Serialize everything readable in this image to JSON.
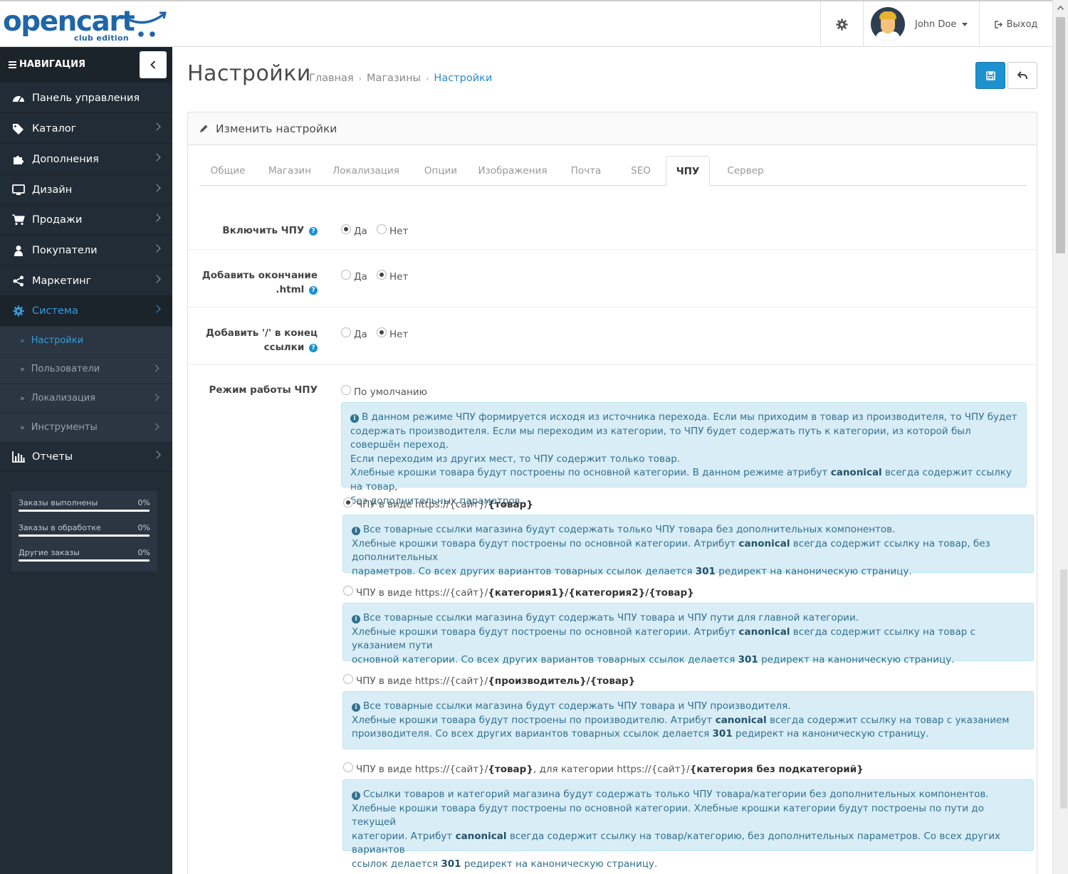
{
  "header": {
    "logo_text": "opencart",
    "logo_sub": "club edition",
    "user_name": "John Doe",
    "logout_label": "Выход"
  },
  "sidebar": {
    "nav_title": "НАВИГАЦИЯ",
    "items": [
      {
        "label": "Панель управления",
        "icon": "dashboard-icon"
      },
      {
        "label": "Каталог",
        "icon": "tags-icon"
      },
      {
        "label": "Дополнения",
        "icon": "puzzle-icon"
      },
      {
        "label": "Дизайн",
        "icon": "desktop-icon"
      },
      {
        "label": "Продажи",
        "icon": "cart-icon"
      },
      {
        "label": "Покупатели",
        "icon": "user-icon"
      },
      {
        "label": "Маркетинг",
        "icon": "share-icon"
      },
      {
        "label": "Система",
        "icon": "cog-icon"
      }
    ],
    "sub_items": [
      {
        "label": "Настройки"
      },
      {
        "label": "Пользователи"
      },
      {
        "label": "Локализация"
      },
      {
        "label": "Инструменты"
      }
    ],
    "reports_label": "Отчеты",
    "stats": [
      {
        "label": "Заказы выполнены",
        "value": "0%",
        "progress": 0
      },
      {
        "label": "Заказы в обработке",
        "value": "0%",
        "progress": 0
      },
      {
        "label": "Другие заказы",
        "value": "0%",
        "progress": 0
      }
    ]
  },
  "page": {
    "title": "Настройки",
    "breadcrumb": [
      "Главная",
      "Магазины",
      "Настройки"
    ]
  },
  "panel": {
    "heading": "Изменить настройки",
    "tabs": [
      "Общие",
      "Магазин",
      "Локализация",
      "Опции",
      "Изображения",
      "Почта",
      "SEO",
      "ЧПУ",
      "Сервер"
    ],
    "active_tab": "ЧПУ"
  },
  "form": {
    "yes": "Да",
    "no": "Нет",
    "enable_label": "Включить ЧПУ",
    "html_label_1": "Добавить окончание",
    "html_label_2": ".html",
    "slash_label_1": "Добавить '/' в конец",
    "slash_label_2": "ссылки",
    "mode_label": "Режим работы ЧПУ",
    "mode_default": "По умолчанию",
    "info_default": {
      "l1": "В данном режиме ЧПУ формируется исходя из источника перехода. Если мы приходим в товар из производителя, то ЧПУ будет",
      "l2": "содержать производителя. Если мы переходим из категории, то ЧПУ будет содержать путь к категории, из которой был совершён переход.",
      "l3": "Если переходим из других мест, то ЧПУ содержит только товар.",
      "l4a": "Хлебные крошки товара будут построены по основной категории. В данном режиме атрибут ",
      "l4b": "canonical",
      "l4c": " всегда содержит ссылку на товар,",
      "l5": "без дополнительных параметров."
    },
    "opt1": {
      "prefix": "ЧПУ в виде https://{сайт}/",
      "bold": "{товар}"
    },
    "info1": {
      "l1": "Все товарные ссылки магазина будут содержать только ЧПУ товара без дополнительных компонентов.",
      "l2a": "Хлебные крошки товара будут построены по основной категории. Атрибут ",
      "l2b": "canonical",
      "l2c": " всегда содержит ссылку на товар, без дополнительных",
      "l3a": "параметров. Со всех других вариантов товарных ссылок делается ",
      "l3b": "301",
      "l3c": " редирект на каноническую страницу."
    },
    "opt2": {
      "prefix": "ЧПУ в виде https://{сайт}/",
      "bold": "{категория1}/{категория2}/{товар}"
    },
    "info2": {
      "l1": "Все товарные ссылки магазина будут содержать ЧПУ товара и ЧПУ пути для главной категории.",
      "l2a": "Хлебные крошки товара будут построены по основной категории. Атрибут ",
      "l2b": "canonical",
      "l2c": " всегда содержит ссылку на товар с указанием пути",
      "l3a": "основной категории. Со всех других вариантов товарных ссылок делается ",
      "l3b": "301",
      "l3c": " редирект на каноническую страницу."
    },
    "opt3": {
      "prefix": "ЧПУ в виде https://{сайт}/",
      "bold": "{производитель}/{товар}"
    },
    "info3": {
      "l1": "Все товарные ссылки магазина будут содержать ЧПУ товара и ЧПУ производителя.",
      "l2a": "Хлебные крошки товара будут построены по производителю. Атрибут ",
      "l2b": "canonical",
      "l2c": " всегда содержит ссылку на товар с указанием",
      "l3a": "производителя. Со всех других вариантов товарных ссылок делается ",
      "l3b": "301",
      "l3c": " редирект на каноническую страницу."
    },
    "opt4": {
      "prefix": "ЧПУ в виде https://{сайт}/",
      "bold1": "{товар}",
      "mid": ", для категории https://{сайт}/",
      "bold2": "{категория без подкатегорий}"
    },
    "info4": {
      "l1": "Ссылки товаров и категорий магазина будут содержать только ЧПУ товара/категории без дополнительных компонентов.",
      "l2": "Хлебные крошки товара будут построены по основной категории. Хлебные крошки категории будут построены по пути до текущей",
      "l3a": "категории. Атрибут ",
      "l3b": "canonical",
      "l3c": " всегда содержит ссылку на товар/категорию, без дополнительных параметров. Со всех других вариантов",
      "l4a": "ссылок делается ",
      "l4b": "301",
      "l4c": " редирект на каноническую страницу."
    }
  },
  "colors": {
    "sidebar_bg": "#222c36",
    "accent": "#1e91cf",
    "info_bg": "#d9edf7",
    "info_text": "#31708f"
  }
}
